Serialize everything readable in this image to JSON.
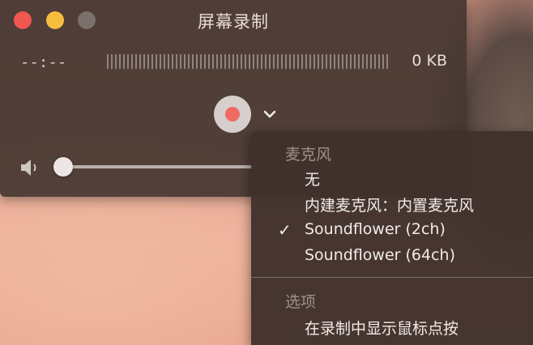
{
  "window": {
    "title": "屏幕录制",
    "elapsed_time": "--:--",
    "file_size": "0 KB",
    "volume_level": 0
  },
  "menu": {
    "microphone_header": "麦克风",
    "microphone_options": [
      "无",
      "内建麦克风：内置麦克风",
      "Soundflower (2ch)",
      "Soundflower (64ch)"
    ],
    "selected_option": "Soundflower (2ch)",
    "checkmark": "✓",
    "options_header": "选项",
    "show_clicks_label": "在录制中显示鼠标点按"
  },
  "colors": {
    "record": "#f06a62",
    "close": "#f0574f",
    "minimize": "#f5bd3d"
  },
  "icons": [
    "close-icon",
    "minimize-icon",
    "zoom-icon",
    "record-icon",
    "chevron-down-icon",
    "speaker-icon",
    "checkmark-icon"
  ]
}
